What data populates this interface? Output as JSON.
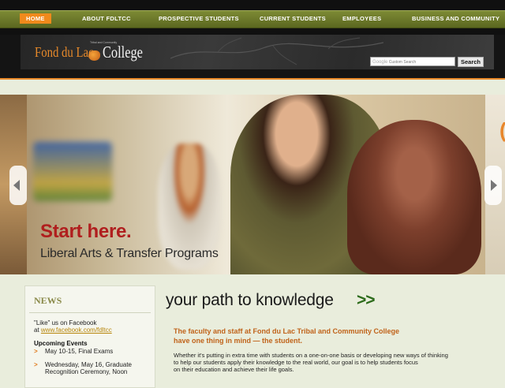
{
  "nav": {
    "items": [
      {
        "label": "Home",
        "active": true
      },
      {
        "label": "About FDLTCC",
        "active": false
      },
      {
        "label": "Prospective Students",
        "active": false
      },
      {
        "label": "Current Students",
        "active": false
      },
      {
        "label": "Employees",
        "active": false
      },
      {
        "label": "Business and Community",
        "active": false
      }
    ],
    "active_color": "#f08a1c"
  },
  "header": {
    "logo": {
      "name_left": "Fond du Lac",
      "name_right": "College",
      "small_text": "Tribal and Community"
    },
    "search": {
      "google_label": "Google",
      "placeholder": "Custom Search",
      "button_label": "Search"
    }
  },
  "hero": {
    "title": "Start here.",
    "subtitle": "Liberal Arts & Transfer Programs",
    "title_color": "#b01e1e"
  },
  "news": {
    "title": "NEWS",
    "facebook_line1": "\"Like\" us on Facebook",
    "facebook_at": "at",
    "facebook_link": "www.facebook.com/fdltcc",
    "events_title": "Upcoming Events",
    "events": [
      {
        "line1": "May 10-15, Final Exams",
        "line2": ""
      },
      {
        "line1": "Wednesday, May 16, Graduate",
        "line2": "Recognition Ceremony, Noon"
      }
    ]
  },
  "main": {
    "title": "your path to knowledge",
    "title_arrows": ">>",
    "intro_line1": "The faculty and staff at Fond du Lac Tribal and Community College",
    "intro_line2": "have one thing in mind — the student.",
    "body_line1": "Whether it's putting in extra time with students on a one-on-one basis or developing new ways of thinking",
    "body_line2": "to help our students apply their knowledge to the real world, our goal is to help students focus",
    "body_line3": "on their education and achieve their life goals."
  }
}
